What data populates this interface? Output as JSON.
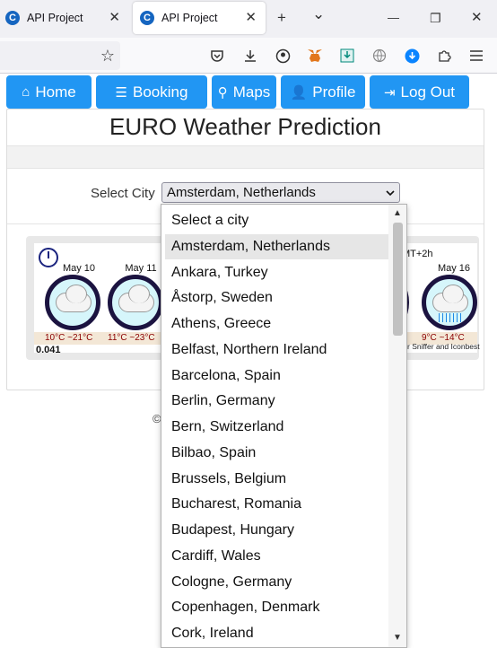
{
  "browser": {
    "tabs": [
      {
        "label": "API Project",
        "favicon": "C",
        "active": false
      },
      {
        "label": "API Project",
        "favicon": "C",
        "active": true
      }
    ],
    "new_tab_symbol": "+",
    "tab_list_symbol": "⌄",
    "window_controls": {
      "minimize": "—",
      "restore": "❐",
      "close": "✕"
    },
    "toolbar_icons": [
      "pocket-icon",
      "download-icon",
      "account-icon",
      "metamask-icon",
      "downloads-panel-icon",
      "globe-icon",
      "update-icon",
      "extensions-icon",
      "menu-icon"
    ],
    "bookmark_symbol": "☆"
  },
  "colors": {
    "accent": "#2196f3",
    "favicon": "#1565c0",
    "temp_text": "#8b0000",
    "icon_ring": "#1b1340"
  },
  "site_nav": [
    {
      "icon": "⌂",
      "label": "Home"
    },
    {
      "icon": "☰",
      "label": "Booking"
    },
    {
      "icon": "⚲",
      "label": "Maps"
    },
    {
      "icon": "👤",
      "label": "Profile"
    },
    {
      "icon": "⇥",
      "label": "Log Out"
    }
  ],
  "main": {
    "title": "EURO Weather Prediction",
    "select_label": "Select City",
    "selected_city": "Amsterdam, Netherlands",
    "copyright": "©"
  },
  "weather_widget": {
    "days": [
      {
        "date": "May 10",
        "low": "10°C",
        "high": "~21°C",
        "icon": "cloudy-icon"
      },
      {
        "date": "May 11",
        "low": "11°C",
        "high": "~23°C",
        "icon": "cloudy-icon"
      },
      {
        "date": "May 16",
        "low": "9°C",
        "high": "~14°C",
        "icon": "rain-icon"
      }
    ],
    "timezone": "MT+2h",
    "credit": "r Sniffer and Iconbest",
    "code": "0.041"
  },
  "city_options": [
    "Select a city",
    "Amsterdam, Netherlands",
    "Ankara, Turkey",
    "Åstorp, Sweden",
    "Athens, Greece",
    "Belfast, Northern Ireland",
    "Barcelona, Spain",
    "Berlin, Germany",
    "Bern, Switzerland",
    "Bilbao, Spain",
    "Brussels, Belgium",
    "Bucharest, Romania",
    "Budapest, Hungary",
    "Cardiff, Wales",
    "Cologne, Germany",
    "Copenhagen, Denmark",
    "Cork, Ireland"
  ],
  "selected_option_index": 1
}
